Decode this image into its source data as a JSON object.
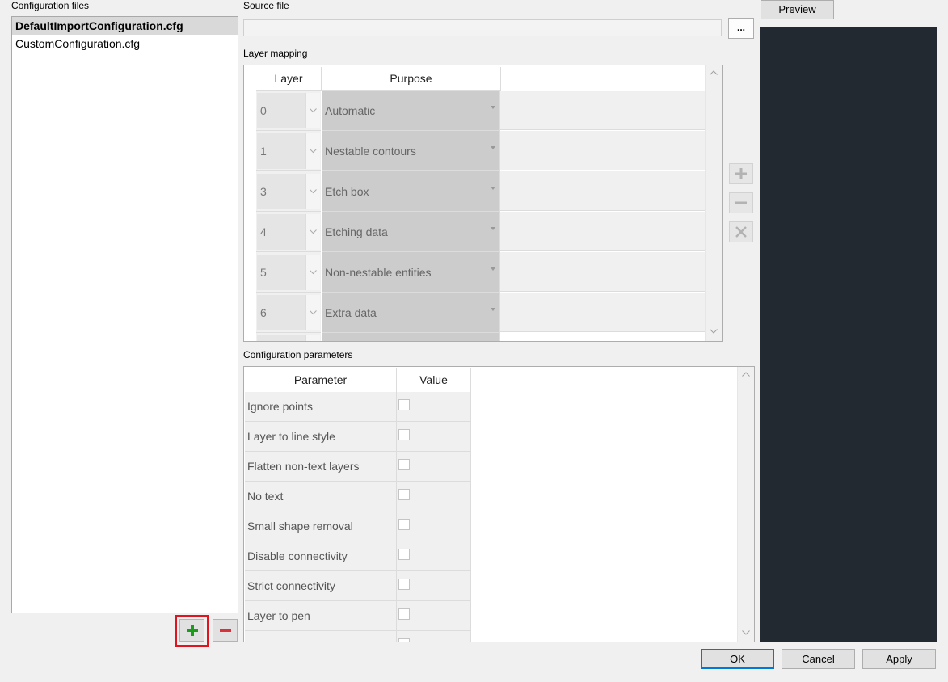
{
  "config_files": {
    "label": "Configuration files",
    "items": [
      {
        "name": "DefaultImportConfiguration.cfg",
        "selected": true
      },
      {
        "name": "CustomConfiguration.cfg",
        "selected": false
      }
    ],
    "add_icon": "plus-icon",
    "remove_icon": "minus-icon"
  },
  "source_file": {
    "label": "Source file",
    "value": "",
    "browse_label": "..."
  },
  "layer_mapping": {
    "label": "Layer mapping",
    "columns": [
      "Layer",
      "Purpose"
    ],
    "rows": [
      {
        "layer": "0",
        "purpose": "Automatic"
      },
      {
        "layer": "1",
        "purpose": "Nestable contours"
      },
      {
        "layer": "3",
        "purpose": "Etch box"
      },
      {
        "layer": "4",
        "purpose": "Etching data"
      },
      {
        "layer": "5",
        "purpose": "Non-nestable entities"
      },
      {
        "layer": "6",
        "purpose": "Extra data"
      }
    ],
    "side_buttons": [
      "plus-icon",
      "minus-icon",
      "close-icon"
    ]
  },
  "config_parameters": {
    "label": "Configuration parameters",
    "columns": [
      "Parameter",
      "Value"
    ],
    "rows": [
      {
        "name": "Ignore points",
        "checked": false
      },
      {
        "name": "Layer to line style",
        "checked": false
      },
      {
        "name": "Flatten non-text layers",
        "checked": false
      },
      {
        "name": "No text",
        "checked": false
      },
      {
        "name": "Small shape removal",
        "checked": false
      },
      {
        "name": "Disable connectivity",
        "checked": false
      },
      {
        "name": "Strict connectivity",
        "checked": false
      },
      {
        "name": "Layer to pen",
        "checked": false
      }
    ]
  },
  "preview": {
    "button_label": "Preview",
    "canvas_color": "#222930"
  },
  "dialog_buttons": {
    "ok": "OK",
    "cancel": "Cancel",
    "apply": "Apply"
  },
  "colors": {
    "highlight_outline": "#e0141e",
    "plus_green": "#1a9e1a",
    "minus_red": "#d9303a"
  }
}
